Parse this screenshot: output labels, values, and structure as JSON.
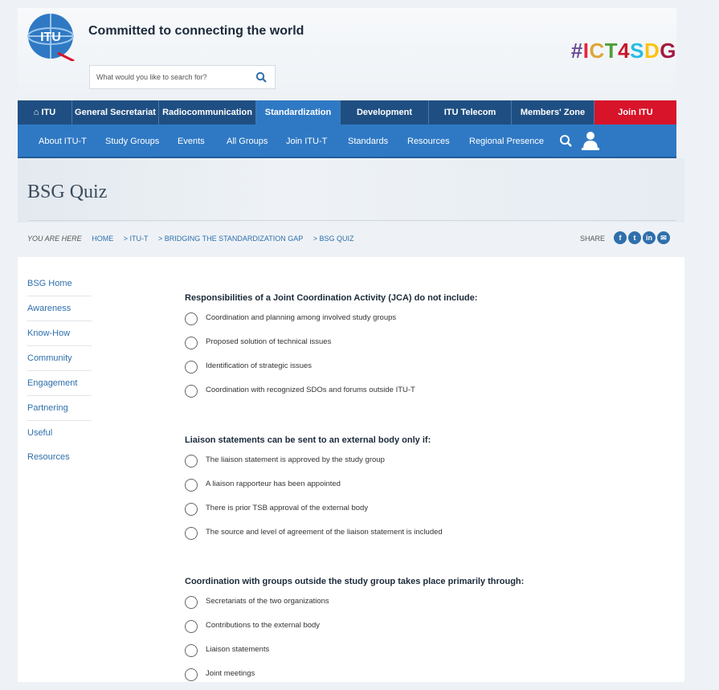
{
  "header": {
    "tagline": "Committed to connecting the world",
    "logo_text": "ITU",
    "hashtag_parts": [
      "#",
      "I",
      "C",
      "T",
      "4",
      "S",
      "D",
      "G"
    ],
    "search_placeholder": "What would you like to search for?"
  },
  "nav_primary": [
    {
      "label": "ITU",
      "icon": "home-icon"
    },
    {
      "label": "General Secretariat"
    },
    {
      "label": "Radiocommunication"
    },
    {
      "label": "Standardization",
      "active": true
    },
    {
      "label": "Development"
    },
    {
      "label": "ITU Telecom"
    },
    {
      "label": "Members' Zone"
    },
    {
      "label": "Join ITU"
    }
  ],
  "nav_secondary": [
    "About ITU-T",
    "Study Groups",
    "Events",
    "All Groups",
    "Join ITU-T",
    "Standards",
    "Resources",
    "Regional Presence"
  ],
  "page": {
    "title": "BSG Quiz"
  },
  "breadcrumb": {
    "prefix": "YOU ARE HERE",
    "items": [
      "HOME",
      "> ITU-T",
      "> BRIDGING THE STANDARDIZATION GAP",
      "> BSG QUIZ"
    ]
  },
  "share": {
    "label": "SHARE",
    "icons": [
      "facebook-icon",
      "twitter-icon",
      "linkedin-icon",
      "email-icon"
    ]
  },
  "sidebar": [
    "BSG Home",
    "Awareness",
    "Know-How",
    "Community",
    "Engagement",
    "Partnering",
    "Useful Resources"
  ],
  "questions": [
    {
      "text": "Responsibilities of a Joint Coordination Activity (JCA) do not include:",
      "options": [
        "Coordination and planning among involved study groups",
        "Proposed solution of technical issues",
        "Identification of strategic issues",
        "Coordination with recognized SDOs and forums outside ITU-T"
      ]
    },
    {
      "text": "Liaison statements can be sent to an external body only if:",
      "options": [
        "The liaison statement is approved by the study group",
        "A liaison rapporteur has been appointed",
        "There is prior TSB approval of the external body",
        "The source and level of agreement of the liaison statement is included"
      ]
    },
    {
      "text": "Coordination with groups outside the study group takes place primarily through:",
      "options": [
        "Secretariats of the two organizations",
        "Contributions to the external body",
        "Liaison statements",
        "Joint meetings"
      ]
    }
  ],
  "colors": {
    "nav_dark": "#1f4f82",
    "nav_accent": "#2f79c4",
    "join_red": "#d7142a",
    "link": "#2f6fab"
  }
}
